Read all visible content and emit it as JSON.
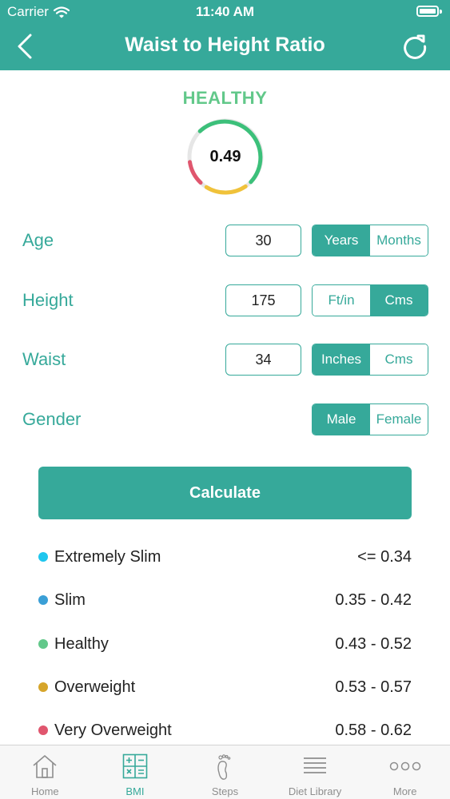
{
  "status_bar": {
    "carrier": "Carrier",
    "time": "11:40 AM"
  },
  "nav": {
    "title": "Waist to Height Ratio",
    "back_icon": "chevron-left-icon",
    "refresh_icon": "refresh-icon"
  },
  "result": {
    "label": "HEALTHY",
    "value": "0.49",
    "label_color": "#62c88a"
  },
  "form": {
    "age": {
      "label": "Age",
      "value": "30",
      "units": [
        "Years",
        "Months"
      ],
      "selected": "Years"
    },
    "height": {
      "label": "Height",
      "value": "175",
      "units": [
        "Ft/in",
        "Cms"
      ],
      "selected": "Cms"
    },
    "waist": {
      "label": "Waist",
      "value": "34",
      "units": [
        "Inches",
        "Cms"
      ],
      "selected": "Inches"
    },
    "gender": {
      "label": "Gender",
      "options": [
        "Male",
        "Female"
      ],
      "selected": "Male"
    }
  },
  "calculate_label": "Calculate",
  "legend": [
    {
      "name": "Extremely Slim",
      "range": "<= 0.34",
      "color": "#1fc6ee"
    },
    {
      "name": "Slim",
      "range": "0.35 - 0.42",
      "color": "#3a9fd6"
    },
    {
      "name": "Healthy",
      "range": "0.43 - 0.52",
      "color": "#62c88a"
    },
    {
      "name": "Overweight",
      "range": "0.53 - 0.57",
      "color": "#d6a52a"
    },
    {
      "name": "Very Overweight",
      "range": "0.58 - 0.62",
      "color": "#e0566e"
    }
  ],
  "tabs": [
    {
      "label": "Home",
      "icon": "home-icon"
    },
    {
      "label": "BMI",
      "icon": "calculator-icon",
      "active": true
    },
    {
      "label": "Steps",
      "icon": "footprint-icon"
    },
    {
      "label": "Diet Library",
      "icon": "list-icon"
    },
    {
      "label": "More",
      "icon": "more-icon"
    }
  ],
  "colors": {
    "primary": "#36a99a",
    "tab_inactive": "#8e8e8e"
  }
}
